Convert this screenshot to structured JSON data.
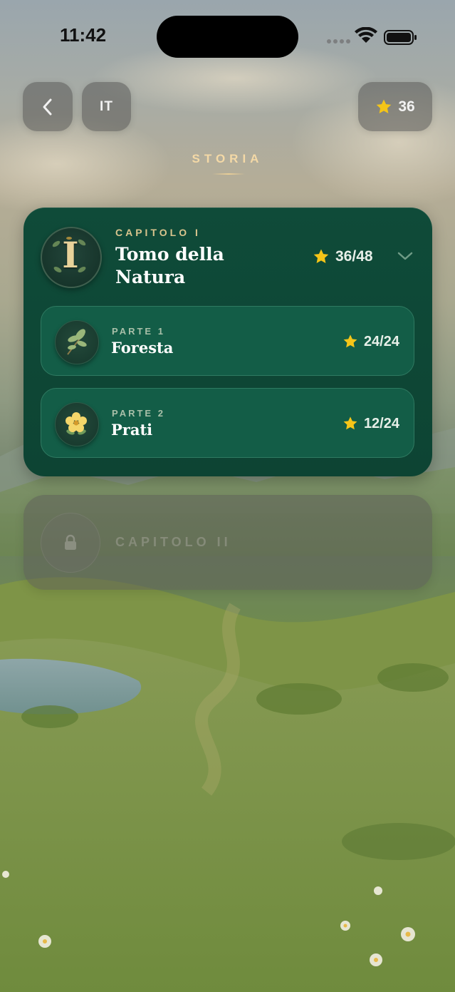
{
  "status_bar": {
    "time": "11:42"
  },
  "header": {
    "back_icon": "chevron-left-icon",
    "language": "IT",
    "total_stars": "36",
    "star_icon": "star-icon"
  },
  "section": {
    "title": "STORIA"
  },
  "chapter": {
    "kicker": "CAPITOLO I",
    "title": "Tomo della Natura",
    "emblem_letter": "I",
    "stars": "36/48",
    "expanded": true,
    "parts": [
      {
        "kicker": "PARTE 1",
        "title": "Foresta",
        "stars": "24/24",
        "icon": "oak-leaf-icon"
      },
      {
        "kicker": "PARTE 2",
        "title": "Prati",
        "stars": "12/24",
        "icon": "buttercup-flower-icon"
      }
    ]
  },
  "locked_chapter": {
    "label": "CAPITOLO II",
    "icon": "lock-icon"
  },
  "colors": {
    "chapter_bg": "#0f4b39",
    "part_bg": "#135d47",
    "star": "#f5c518",
    "kicker_gold": "#d9c48d",
    "section_title": "#f4d9a6"
  }
}
